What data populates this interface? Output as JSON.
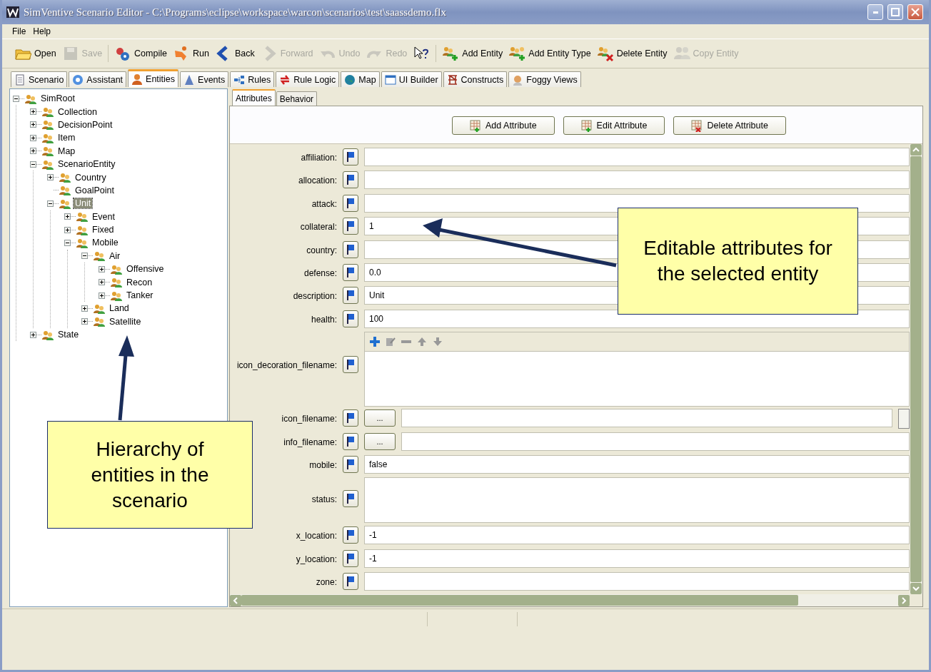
{
  "window": {
    "title": "SimVentive Scenario Editor - C:\\Programs\\eclipse\\workspace\\warcon\\scenarios\\test\\saassdemo.flx"
  },
  "menu": [
    "File",
    "Help"
  ],
  "toolbar": [
    {
      "label": "Open",
      "disabled": false
    },
    {
      "label": "Save",
      "disabled": true
    },
    {
      "label": "Compile",
      "disabled": false
    },
    {
      "label": "Run",
      "disabled": false
    },
    {
      "label": "Back",
      "disabled": false
    },
    {
      "label": "Forward",
      "disabled": true
    },
    {
      "label": "Undo",
      "disabled": true
    },
    {
      "label": "Redo",
      "disabled": true
    },
    {
      "disabled": false
    },
    {
      "label": "Add Entity",
      "disabled": false
    },
    {
      "label": "Add Entity Type",
      "disabled": false
    },
    {
      "label": "Delete Entity",
      "disabled": false
    },
    {
      "label": "Copy Entity",
      "disabled": true
    }
  ],
  "tabs": [
    {
      "label": "Scenario",
      "selected": false
    },
    {
      "label": "Assistant",
      "selected": false
    },
    {
      "label": "Entities",
      "selected": true
    },
    {
      "label": "Events",
      "selected": false
    },
    {
      "label": "Rules",
      "selected": false
    },
    {
      "label": "Rule Logic",
      "selected": false
    },
    {
      "label": "Map",
      "selected": false
    },
    {
      "label": "UI Builder",
      "selected": false
    },
    {
      "label": "Constructs",
      "selected": false
    },
    {
      "label": "Foggy Views",
      "selected": false
    }
  ],
  "tree": [
    {
      "label": "SimRoot",
      "expanded": true,
      "selected": false,
      "children": [
        {
          "label": "Collection",
          "expanded": false,
          "selected": false
        },
        {
          "label": "DecisionPoint",
          "expanded": false,
          "selected": false
        },
        {
          "label": "Item",
          "expanded": false,
          "selected": false
        },
        {
          "label": "Map",
          "expanded": false,
          "selected": false
        },
        {
          "label": "ScenarioEntity",
          "expanded": true,
          "selected": false,
          "children": [
            {
              "label": "Country",
              "expanded": false,
              "selected": false
            },
            {
              "label": "GoalPoint",
              "kind": "leaf",
              "selected": false
            },
            {
              "label": "Unit",
              "expanded": true,
              "selected": true,
              "children": [
                {
                  "label": "Event",
                  "expanded": false,
                  "selected": false
                },
                {
                  "label": "Fixed",
                  "expanded": false,
                  "selected": false
                },
                {
                  "label": "Mobile",
                  "expanded": true,
                  "selected": false,
                  "children": [
                    {
                      "label": "Air",
                      "expanded": true,
                      "selected": false,
                      "children": [
                        {
                          "label": "Offensive",
                          "expanded": false,
                          "selected": false
                        },
                        {
                          "label": "Recon",
                          "expanded": false,
                          "selected": false
                        },
                        {
                          "label": "Tanker",
                          "expanded": false,
                          "selected": false
                        }
                      ]
                    },
                    {
                      "label": "Land",
                      "expanded": false,
                      "selected": false
                    },
                    {
                      "label": "Satellite",
                      "expanded": false,
                      "selected": false
                    }
                  ]
                }
              ]
            }
          ]
        },
        {
          "label": "State",
          "expanded": false,
          "selected": false
        }
      ]
    }
  ],
  "detail_tabs": [
    {
      "label": "Attributes",
      "selected": true
    },
    {
      "label": "Behavior",
      "selected": false
    }
  ],
  "attribute_buttons": [
    "Add Attribute",
    "Edit Attribute",
    "Delete Attribute"
  ],
  "attributes": [
    {
      "kind": "text",
      "label": "affiliation:"
    },
    {
      "kind": "text",
      "label": "allocation:"
    },
    {
      "kind": "text",
      "label": "attack:"
    },
    {
      "kind": "text",
      "label": "collateral:",
      "value": "1"
    },
    {
      "kind": "text",
      "label": "country:"
    },
    {
      "kind": "text",
      "label": "defense:",
      "value": "0.0"
    },
    {
      "kind": "text",
      "label": "description:",
      "value": "Unit"
    },
    {
      "kind": "text",
      "label": "health:",
      "value": "100"
    },
    {
      "kind": "list",
      "label": "icon_decoration_filename:"
    },
    {
      "kind": "file",
      "label": "icon_filename:",
      "button": "..."
    },
    {
      "kind": "file",
      "label": "info_filename:",
      "button": "..."
    },
    {
      "kind": "text",
      "label": "mobile:",
      "value": "false"
    },
    {
      "kind": "textarea",
      "label": "status:"
    },
    {
      "kind": "text",
      "label": "x_location:",
      "value": "-1"
    },
    {
      "kind": "text",
      "label": "y_location:",
      "value": "-1"
    },
    {
      "kind": "text",
      "label": "zone:"
    }
  ],
  "callouts": [
    {
      "text": "Editable attributes for the selected entity"
    },
    {
      "text": "Hierarchy of entities in the scenario"
    }
  ]
}
